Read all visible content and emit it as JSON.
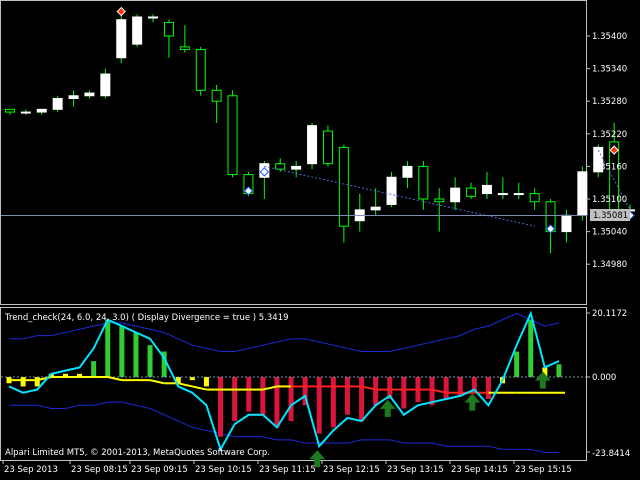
{
  "window": {
    "indicator_title": "Trend_check(24, 6.0, 24, 3.0) ( Display Divergence = true ) 5.3419",
    "copyright": "Alpari Limited MT5, © 2001-2013, MetaQuotes Software Corp.",
    "current_price": "1.35081"
  },
  "price_axis": [
    "1.35400",
    "1.35340",
    "1.35280",
    "1.35220",
    "1.35160",
    "1.35100",
    "1.35040",
    "1.34980"
  ],
  "indicator_axis": [
    "20.1172",
    "0.000",
    "-23.8414"
  ],
  "time_axis": [
    "23 Sep 2013",
    "23 Sep 08:15",
    "23 Sep 09:15",
    "23 Sep 10:15",
    "23 Sep 11:15",
    "23 Sep 12:15",
    "23 Sep 13:15",
    "23 Sep 14:15",
    "23 Sep 15:15"
  ],
  "colors": {
    "candle_up": "#ffffff",
    "candle_down": "#000000",
    "wick": "#00ff00",
    "grid": "#7c8fb0",
    "hist_up": "#32cd32",
    "hist_down": "#dc143c",
    "hist_neutral": "#ffff00",
    "oscillator": "#00e5ff",
    "bands": "#1a2bd6",
    "signal_up": "#ffff00",
    "signal_down": "#ff2020",
    "arrow": "#1e7a1e"
  },
  "chart_data": [
    {
      "type": "candlestick",
      "title": "",
      "ylim": [
        1.3495,
        1.3546
      ],
      "candles": [
        {
          "o": 1.35265,
          "h": 1.35265,
          "l": 1.35255,
          "c": 1.3526
        },
        {
          "o": 1.3526,
          "h": 1.35265,
          "l": 1.35255,
          "c": 1.3526
        },
        {
          "o": 1.3526,
          "h": 1.35265,
          "l": 1.35255,
          "c": 1.35265
        },
        {
          "o": 1.35265,
          "h": 1.3529,
          "l": 1.3526,
          "c": 1.35285
        },
        {
          "o": 1.35285,
          "h": 1.353,
          "l": 1.3527,
          "c": 1.3529
        },
        {
          "o": 1.3529,
          "h": 1.353,
          "l": 1.35285,
          "c": 1.35295
        },
        {
          "o": 1.3529,
          "h": 1.3534,
          "l": 1.35285,
          "c": 1.3533
        },
        {
          "o": 1.3536,
          "h": 1.3545,
          "l": 1.3535,
          "c": 1.3543
        },
        {
          "o": 1.35385,
          "h": 1.3544,
          "l": 1.3538,
          "c": 1.35435
        },
        {
          "o": 1.35435,
          "h": 1.3544,
          "l": 1.35425,
          "c": 1.35435
        },
        {
          "o": 1.35425,
          "h": 1.3543,
          "l": 1.3536,
          "c": 1.354
        },
        {
          "o": 1.3538,
          "h": 1.3542,
          "l": 1.3537,
          "c": 1.35375
        },
        {
          "o": 1.35375,
          "h": 1.3538,
          "l": 1.3529,
          "c": 1.353
        },
        {
          "o": 1.353,
          "h": 1.3531,
          "l": 1.3524,
          "c": 1.3528
        },
        {
          "o": 1.3529,
          "h": 1.353,
          "l": 1.3514,
          "c": 1.35145
        },
        {
          "o": 1.35145,
          "h": 1.3515,
          "l": 1.35105,
          "c": 1.3511
        },
        {
          "o": 1.3514,
          "h": 1.3517,
          "l": 1.351,
          "c": 1.35165
        },
        {
          "o": 1.35165,
          "h": 1.35175,
          "l": 1.3515,
          "c": 1.35155
        },
        {
          "o": 1.35155,
          "h": 1.3517,
          "l": 1.3514,
          "c": 1.3516
        },
        {
          "o": 1.35165,
          "h": 1.3524,
          "l": 1.35155,
          "c": 1.35235
        },
        {
          "o": 1.35225,
          "h": 1.35235,
          "l": 1.3516,
          "c": 1.35165
        },
        {
          "o": 1.35195,
          "h": 1.352,
          "l": 1.3502,
          "c": 1.3505
        },
        {
          "o": 1.3506,
          "h": 1.3511,
          "l": 1.3504,
          "c": 1.3508
        },
        {
          "o": 1.3508,
          "h": 1.3512,
          "l": 1.3507,
          "c": 1.35085
        },
        {
          "o": 1.3509,
          "h": 1.3515,
          "l": 1.35085,
          "c": 1.3514
        },
        {
          "o": 1.3514,
          "h": 1.3517,
          "l": 1.3512,
          "c": 1.3516
        },
        {
          "o": 1.3516,
          "h": 1.3517,
          "l": 1.3508,
          "c": 1.351
        },
        {
          "o": 1.351,
          "h": 1.3512,
          "l": 1.3504,
          "c": 1.35095
        },
        {
          "o": 1.35095,
          "h": 1.3514,
          "l": 1.3508,
          "c": 1.3512
        },
        {
          "o": 1.3512,
          "h": 1.3513,
          "l": 1.351,
          "c": 1.35105
        },
        {
          "o": 1.3511,
          "h": 1.3515,
          "l": 1.351,
          "c": 1.35125
        },
        {
          "o": 1.3511,
          "h": 1.3514,
          "l": 1.351,
          "c": 1.3511
        },
        {
          "o": 1.3511,
          "h": 1.3513,
          "l": 1.351,
          "c": 1.3511
        },
        {
          "o": 1.3511,
          "h": 1.3512,
          "l": 1.3508,
          "c": 1.35095
        },
        {
          "o": 1.35095,
          "h": 1.351,
          "l": 1.35,
          "c": 1.3504
        },
        {
          "o": 1.3504,
          "h": 1.3508,
          "l": 1.3502,
          "c": 1.3507
        },
        {
          "o": 1.3507,
          "h": 1.3516,
          "l": 1.3506,
          "c": 1.3515
        },
        {
          "o": 1.3515,
          "h": 1.352,
          "l": 1.3514,
          "c": 1.35195
        },
        {
          "o": 1.35205,
          "h": 1.3524,
          "l": 1.3506,
          "c": 1.3508
        },
        {
          "o": 1.3508,
          "h": 1.3509,
          "l": 1.3507,
          "c": 1.3508
        }
      ],
      "divergence_line": [
        [
          16,
          1.3516
        ],
        [
          33,
          1.3505
        ]
      ],
      "divergence_line2": [
        [
          37,
          1.3519
        ],
        [
          39,
          1.3508
        ]
      ],
      "markers_up": [
        [
          15,
          1.35115
        ],
        [
          16,
          1.3515
        ],
        [
          34,
          1.35045
        ],
        [
          39,
          1.3507
        ]
      ],
      "markers_down": [
        [
          7,
          1.35445
        ],
        [
          38,
          1.3519
        ]
      ]
    },
    {
      "type": "bar",
      "title": "",
      "ylim": [
        -23.8414,
        20.1172
      ],
      "series": [
        {
          "values": [
            -2,
            -3,
            -3,
            1,
            1,
            1,
            5,
            18,
            16,
            14,
            10,
            8,
            -2,
            -1,
            -3,
            -19,
            -14,
            -11,
            -12,
            -16,
            -14,
            -9,
            -18,
            -16,
            -12,
            -14,
            -9,
            -7,
            -10,
            -8,
            -9,
            -7,
            -6,
            -5,
            -7,
            -2,
            8,
            18,
            3,
            4
          ]
        }
      ],
      "oscillator": [
        -3,
        -5,
        -4,
        1,
        2,
        3,
        9,
        18,
        16,
        14,
        12,
        6,
        -3,
        -5,
        -9,
        -23,
        -15,
        -12,
        -12,
        -16,
        -9,
        -6,
        -22,
        -17,
        -13,
        -14,
        -9,
        -6,
        -12,
        -9,
        -8,
        -7,
        -6,
        -4,
        -9,
        -1,
        10,
        20,
        3,
        5
      ],
      "signal": [
        -1,
        -1,
        -1,
        0,
        0,
        0,
        0,
        0,
        -1,
        -1,
        -1,
        -2,
        -2,
        -3,
        -4,
        -4,
        -4,
        -4,
        -4,
        -3,
        -3,
        -3,
        -3,
        -3,
        -3,
        -3,
        -4,
        -4,
        -4,
        -4,
        -4,
        -5,
        -5,
        -5,
        -5,
        -5,
        -5
      ],
      "upper_band": [
        12,
        12,
        13,
        13,
        14,
        15,
        16,
        17,
        17,
        16,
        15,
        14,
        12,
        10,
        9,
        8,
        8,
        9,
        10,
        11,
        12,
        12,
        11,
        10,
        9,
        8,
        8,
        8,
        9,
        10,
        11,
        12,
        13,
        15,
        16,
        18,
        20,
        18,
        16,
        17
      ],
      "lower_band": [
        -9,
        -9,
        -9,
        -10,
        -10,
        -9,
        -9,
        -8,
        -8,
        -9,
        -10,
        -12,
        -14,
        -16,
        -17,
        -18,
        -19,
        -19,
        -19,
        -20,
        -20,
        -21,
        -21,
        -21,
        -21,
        -20,
        -20,
        -20,
        -21,
        -21,
        -21,
        -22,
        -22,
        -22,
        -22,
        -23,
        -23,
        -23,
        -24,
        -24
      ],
      "arrow_bars": [
        22,
        27,
        33,
        38
      ]
    }
  ]
}
